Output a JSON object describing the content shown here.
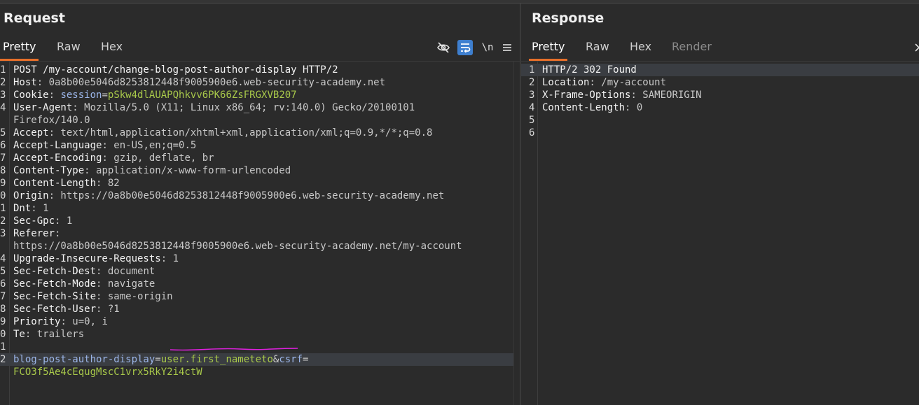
{
  "request": {
    "title": "Request",
    "tabs": [
      "Pretty",
      "Raw",
      "Hex"
    ],
    "toolbar": {
      "newline_label": "\\n"
    },
    "lines": [
      {
        "n": "1",
        "parts": [
          {
            "t": "POST /my-account/change-blog-post-author-display HTTP/2",
            "c": "k"
          }
        ]
      },
      {
        "n": "2",
        "parts": [
          {
            "t": "Host",
            "c": "k"
          },
          {
            "t": ": 0a8b00e5046d8253812448f9005900e6.web-security-academy.net",
            "c": "v"
          }
        ]
      },
      {
        "n": "3",
        "parts": [
          {
            "t": "Cookie",
            "c": "k"
          },
          {
            "t": ": ",
            "c": "v"
          },
          {
            "t": "session",
            "c": "pk"
          },
          {
            "t": "=",
            "c": "v"
          },
          {
            "t": "pSkw4dlAUAPQhkvv6PK66ZsFRGXVB207",
            "c": "g"
          }
        ]
      },
      {
        "n": "4",
        "parts": [
          {
            "t": "User-Agent",
            "c": "k"
          },
          {
            "t": ": Mozilla/5.0 (X11; Linux x86_64; rv:140.0) Gecko/20100101",
            "c": "v"
          }
        ]
      },
      {
        "n": "",
        "parts": [
          {
            "t": "Firefox/140.0",
            "c": "v"
          }
        ]
      },
      {
        "n": "5",
        "parts": [
          {
            "t": "Accept",
            "c": "k"
          },
          {
            "t": ": text/html,application/xhtml+xml,application/xml;q=0.9,*/*;q=0.8",
            "c": "v"
          }
        ]
      },
      {
        "n": "6",
        "parts": [
          {
            "t": "Accept-Language",
            "c": "k"
          },
          {
            "t": ": en-US,en;q=0.5",
            "c": "v"
          }
        ]
      },
      {
        "n": "7",
        "parts": [
          {
            "t": "Accept-Encoding",
            "c": "k"
          },
          {
            "t": ": gzip, deflate, br",
            "c": "v"
          }
        ]
      },
      {
        "n": "8",
        "parts": [
          {
            "t": "Content-Type",
            "c": "k"
          },
          {
            "t": ": application/x-www-form-urlencoded",
            "c": "v"
          }
        ]
      },
      {
        "n": "9",
        "parts": [
          {
            "t": "Content-Length",
            "c": "k"
          },
          {
            "t": ": 82",
            "c": "v"
          }
        ]
      },
      {
        "n": "0",
        "parts": [
          {
            "t": "Origin",
            "c": "k"
          },
          {
            "t": ": https://0a8b00e5046d8253812448f9005900e6.web-security-academy.net",
            "c": "v"
          }
        ]
      },
      {
        "n": "1",
        "parts": [
          {
            "t": "Dnt",
            "c": "k"
          },
          {
            "t": ": 1",
            "c": "v"
          }
        ]
      },
      {
        "n": "2",
        "parts": [
          {
            "t": "Sec-Gpc",
            "c": "k"
          },
          {
            "t": ": 1",
            "c": "v"
          }
        ]
      },
      {
        "n": "3",
        "parts": [
          {
            "t": "Referer",
            "c": "k"
          },
          {
            "t": ":",
            "c": "v"
          }
        ]
      },
      {
        "n": "",
        "parts": [
          {
            "t": "https://0a8b00e5046d8253812448f9005900e6.web-security-academy.net/my-account",
            "c": "v"
          }
        ]
      },
      {
        "n": "4",
        "parts": [
          {
            "t": "Upgrade-Insecure-Requests",
            "c": "k"
          },
          {
            "t": ": 1",
            "c": "v"
          }
        ]
      },
      {
        "n": "5",
        "parts": [
          {
            "t": "Sec-Fetch-Dest",
            "c": "k"
          },
          {
            "t": ": document",
            "c": "v"
          }
        ]
      },
      {
        "n": "6",
        "parts": [
          {
            "t": "Sec-Fetch-Mode",
            "c": "k"
          },
          {
            "t": ": navigate",
            "c": "v"
          }
        ]
      },
      {
        "n": "7",
        "parts": [
          {
            "t": "Sec-Fetch-Site",
            "c": "k"
          },
          {
            "t": ": same-origin",
            "c": "v"
          }
        ]
      },
      {
        "n": "8",
        "parts": [
          {
            "t": "Sec-Fetch-User",
            "c": "k"
          },
          {
            "t": ": ?1",
            "c": "v"
          }
        ]
      },
      {
        "n": "9",
        "parts": [
          {
            "t": "Priority",
            "c": "k"
          },
          {
            "t": ": u=0, i",
            "c": "v"
          }
        ]
      },
      {
        "n": "0",
        "parts": [
          {
            "t": "Te",
            "c": "k"
          },
          {
            "t": ": trailers",
            "c": "v"
          }
        ]
      },
      {
        "n": "1",
        "parts": []
      },
      {
        "n": "2",
        "hl": true,
        "parts": [
          {
            "t": "blog-post-author-display",
            "c": "pk"
          },
          {
            "t": "=",
            "c": "v"
          },
          {
            "t": "user.first_nameteto",
            "c": "g"
          },
          {
            "t": "&",
            "c": "v"
          },
          {
            "t": "csrf",
            "c": "pk"
          },
          {
            "t": "=",
            "c": "v"
          }
        ]
      },
      {
        "n": "",
        "parts": [
          {
            "t": "FCO3f5Ae4cEqugMscC1vrx5RkY2i4ctW",
            "c": "g"
          }
        ]
      }
    ]
  },
  "response": {
    "title": "Response",
    "tabs": [
      "Pretty",
      "Raw",
      "Hex",
      "Render"
    ],
    "lines": [
      {
        "n": "1",
        "hl": true,
        "parts": [
          {
            "t": "HTTP/2 302 Found",
            "c": "k"
          }
        ]
      },
      {
        "n": "2",
        "parts": [
          {
            "t": "Location",
            "c": "k"
          },
          {
            "t": ": /my-account",
            "c": "v"
          }
        ]
      },
      {
        "n": "3",
        "parts": [
          {
            "t": "X-Frame-Options",
            "c": "k"
          },
          {
            "t": ": SAMEORIGIN",
            "c": "v"
          }
        ]
      },
      {
        "n": "4",
        "parts": [
          {
            "t": "Content-Length",
            "c": "k"
          },
          {
            "t": ": 0",
            "c": "v"
          }
        ]
      },
      {
        "n": "5",
        "parts": []
      },
      {
        "n": "6",
        "parts": []
      }
    ]
  },
  "icons": {
    "hide": "eye-slash-icon",
    "wrap": "word-wrap-icon",
    "newline": "newline-icon",
    "menu": "hamburger-menu-icon",
    "chevron": "chevron-right-icon"
  },
  "colors": {
    "accent": "#e8702a",
    "toggle_on": "#3e7fcf",
    "value_green": "#a8c84a",
    "param_blue": "#9bb5e8",
    "annotation_pink": "#e020e0"
  }
}
